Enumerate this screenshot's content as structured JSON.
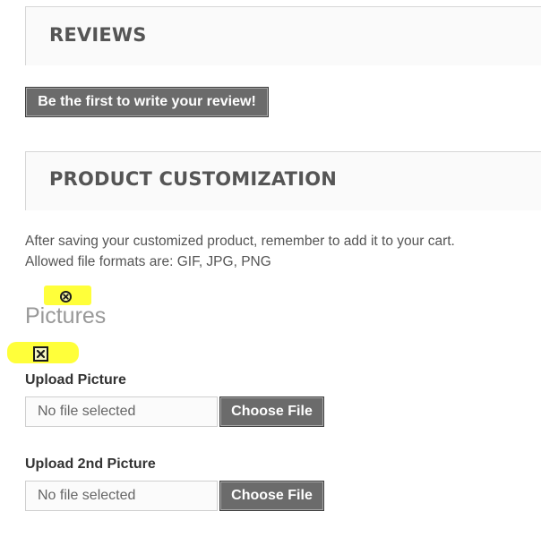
{
  "reviews": {
    "title": "REVIEWS",
    "write_review_button": "Be the first to write your review!"
  },
  "customization": {
    "title": "PRODUCT CUSTOMIZATION",
    "info_line_1": "After saving your customized product, remember to add it to your cart.",
    "info_line_2": "Allowed file formats are: GIF, JPG, PNG",
    "pictures_heading": "Pictures",
    "uploads": [
      {
        "label": "Upload Picture",
        "file_status": "No file selected",
        "button": "Choose File"
      },
      {
        "label": "Upload 2nd Picture",
        "file_status": "No file selected",
        "button": "Choose File"
      }
    ]
  },
  "icons": {
    "marker_1": "circle-x-icon",
    "marker_2": "square-x-icon"
  },
  "colors": {
    "highlight": "#ffff3a",
    "button_bg": "#6b6b6b",
    "heading_text": "#555555",
    "pictures_text": "#999999"
  }
}
